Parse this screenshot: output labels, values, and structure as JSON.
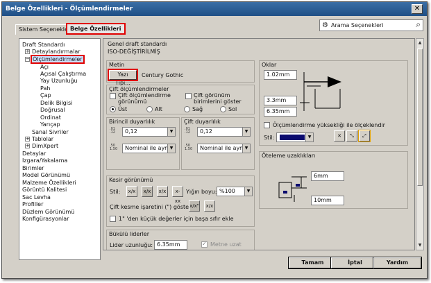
{
  "window": {
    "title": "Belge Özellikleri - Ölçümlendirmeler",
    "close": "✕"
  },
  "tabs": [
    {
      "label": "Sistem Seçenekleri"
    },
    {
      "label": "Belge Özellikleri"
    }
  ],
  "search": {
    "placeholder": "Arama Seçenekleri"
  },
  "tree": {
    "items": [
      {
        "label": "Draft Standardı"
      },
      {
        "label": "Detaylandırmalar"
      },
      {
        "label": "Ölçümlendirmeler"
      },
      {
        "label": "Açı"
      },
      {
        "label": "Açısal Çalıştırma"
      },
      {
        "label": "Yay Uzunluğu"
      },
      {
        "label": "Pah"
      },
      {
        "label": "Çap"
      },
      {
        "label": "Delik Bilgisi"
      },
      {
        "label": "Doğrusal"
      },
      {
        "label": "Ordinat"
      },
      {
        "label": "Yarıçap"
      },
      {
        "label": "Sanal Sivriler"
      },
      {
        "label": "Tablolar"
      },
      {
        "label": "DimXpert"
      },
      {
        "label": "Detaylar"
      },
      {
        "label": "Izgara/Yakalama"
      },
      {
        "label": "Birimler"
      },
      {
        "label": "Model Görünümü"
      },
      {
        "label": "Malzeme Özellikleri"
      },
      {
        "label": "Görüntü Kalitesi"
      },
      {
        "label": "Sac Levha"
      },
      {
        "label": "Profiller"
      },
      {
        "label": "Düzlem Görünümü"
      },
      {
        "label": "Konfigürasyonlar"
      }
    ]
  },
  "general": {
    "label": "Genel draft standardı",
    "value": "ISO-DEĞİŞTİRİLMİŞ"
  },
  "metin": {
    "label": "Metin",
    "button": "Yazı Tipi...",
    "font": "Century Gothic"
  },
  "dual": {
    "label": "Çift ölçümlendirmeler",
    "show_label": "Çift ölçümlendirme görünümü",
    "units_label": "Çift görünüm birimlerini göster",
    "radios": [
      "Üst",
      "Alt",
      "Sağ",
      "Sol"
    ]
  },
  "primary": {
    "label": "Birincil duyarlılık",
    "value": "0,12",
    "tolerance": "Nominal ile aynı",
    "icon1": ".01 .12",
    "icon2": ".50 1.50"
  },
  "dual_precision": {
    "label": "Çift duyarlılık",
    "value": "0,12",
    "tolerance": "Nominal ile aynı",
    "icon1": ".01 .12",
    "icon2": ".50 1.50"
  },
  "fraction": {
    "label": "Kesir görünümü",
    "style_label": "Stil:",
    "styles": [
      "x/x",
      "x/x",
      "x/x",
      "x-xx"
    ],
    "stack_label": "Yığın boyu:",
    "stack_value": "%100",
    "double_prime_label": "Çift kesme işaretini (\") göster:",
    "double_prime_opts": [
      "x/x\"",
      "x/x"
    ],
    "zero_label": "1\" 'den küçük değerler için başa sıfır ekle"
  },
  "bent": {
    "label": "Bükülü liderler",
    "length_label": "Lider uzunluğu:",
    "length_value": "6.35mm",
    "extend_label": "Metne uzat"
  },
  "arrows": {
    "label": "Oklar",
    "size1": "1.02mm",
    "size2": "3.3mm",
    "size3": "6.35mm",
    "scale_label": "Ölçümlendirme yüksekliği ile ölçeklendir",
    "style_label": "Stil:"
  },
  "offset": {
    "label": "Öteleme uzaklıkları",
    "value1": "6mm",
    "value2": "10mm"
  },
  "footer": {
    "ok": "Tamam",
    "cancel": "İptal",
    "help": "Yardım"
  },
  "colors": {
    "titlebar": "#1f4f86",
    "highlight": "#e00000",
    "arrow_swatch": "#0a0a6e"
  }
}
